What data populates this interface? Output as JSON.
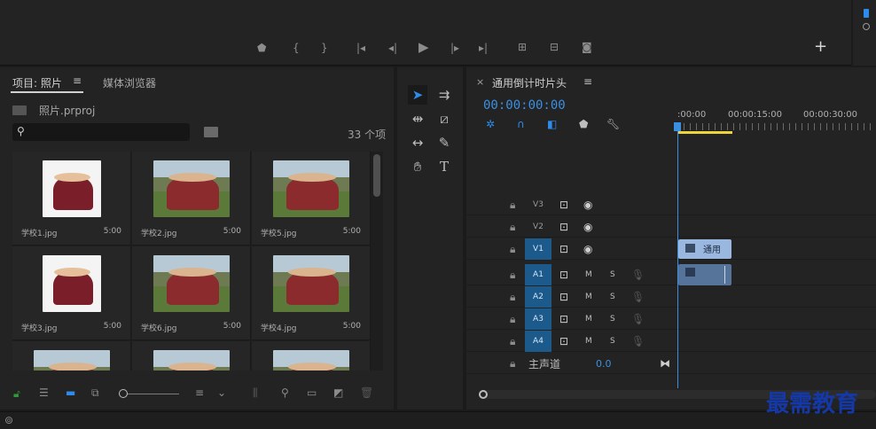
{
  "monitor": {
    "buttons": [
      "marker",
      "in-point",
      "out-point",
      "go-to-in",
      "step-back",
      "play",
      "step-forward",
      "go-to-out",
      "lift",
      "extract",
      "export-frame"
    ],
    "add_label": "+"
  },
  "project": {
    "tab_label": "项目: 照片",
    "menu_label": "≡",
    "media_browser_tab": "媒体浏览器",
    "file_name": "照片.prproj",
    "search_placeholder": "",
    "item_count": "33 个项",
    "items": [
      {
        "name": "学校1.jpg",
        "duration": "5:00",
        "style": "white"
      },
      {
        "name": "学校2.jpg",
        "duration": "5:00",
        "style": "wide"
      },
      {
        "name": "学校5.jpg",
        "duration": "5:00",
        "style": "wide"
      },
      {
        "name": "学校3.jpg",
        "duration": "5:00",
        "style": "white"
      },
      {
        "name": "学校6.jpg",
        "duration": "5:00",
        "style": "wide"
      },
      {
        "name": "学校4.jpg",
        "duration": "5:00",
        "style": "wide"
      },
      {
        "name": "",
        "duration": "",
        "style": "wide"
      },
      {
        "name": "",
        "duration": "",
        "style": "wide"
      },
      {
        "name": "",
        "duration": "",
        "style": "wide"
      }
    ]
  },
  "timeline": {
    "close_label": "×",
    "sequence_name": "通用倒计时片头",
    "menu_label": "≡",
    "timecode": "00:00:00:00",
    "ruler_labels": [
      ":00:00",
      "00:00:15:00",
      "00:00:30:00"
    ],
    "video_tracks": [
      "V3",
      "V2",
      "V1"
    ],
    "audio_tracks": [
      "A1",
      "A2",
      "A3",
      "A4"
    ],
    "mute_label": "M",
    "solo_label": "S",
    "master_label": "主声道",
    "master_value": "0.0",
    "clip_label": "通用"
  },
  "watermark": "最需教育",
  "colors": {
    "accent_blue": "#2d8ceb",
    "timecode_blue": "#3b8fe0",
    "playhead_yellow": "#f0d33a",
    "track_on": "#1c5a8c",
    "clip_video": "#9ab7df",
    "clip_audio": "#56739a",
    "watermark_blue": "#1438a8"
  }
}
